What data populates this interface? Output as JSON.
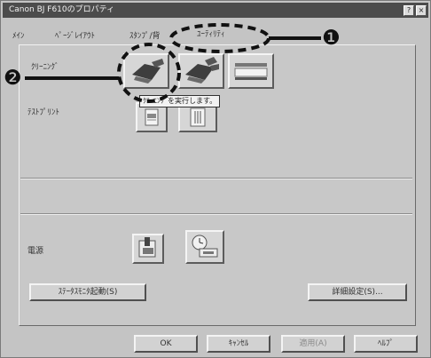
{
  "window": {
    "title": "Canon BJ F610のプロパティ",
    "help_glyph": "?",
    "close_glyph": "×"
  },
  "tabs": [
    {
      "label": "ﾒｲﾝ"
    },
    {
      "label": "ﾍﾟｰｼﾞﾚｲｱｳﾄ"
    },
    {
      "label": "ｽﾀﾝﾌﾟ/背"
    },
    {
      "label": "ﾕｰﾃｨﾘﾃｨ"
    }
  ],
  "sections": {
    "cleaning_label": "ｸﾘｰﾆﾝｸﾞ",
    "test_print_label": "ﾃｽﾄﾌﾟﾘﾝﾄ",
    "power_label": "電源"
  },
  "tooltip": "ｸﾘｰﾆﾝｸﾞを実行します。",
  "buttons": {
    "status_monitor": "ｽﾃｰﾀｽﾓﾆﾀ起動(S)",
    "detail_settings": "詳細設定(S)..."
  },
  "footer": {
    "ok": "OK",
    "cancel": "ｷｬﾝｾﾙ",
    "apply": "適用(A)",
    "help": "ﾍﾙﾌﾟ"
  },
  "callouts": [
    {
      "number": "❶"
    },
    {
      "number": "❷"
    }
  ],
  "colors": {
    "window_bg": "#c4c4c4",
    "titlebar": "#4c4c4c",
    "callout": "#111111"
  }
}
